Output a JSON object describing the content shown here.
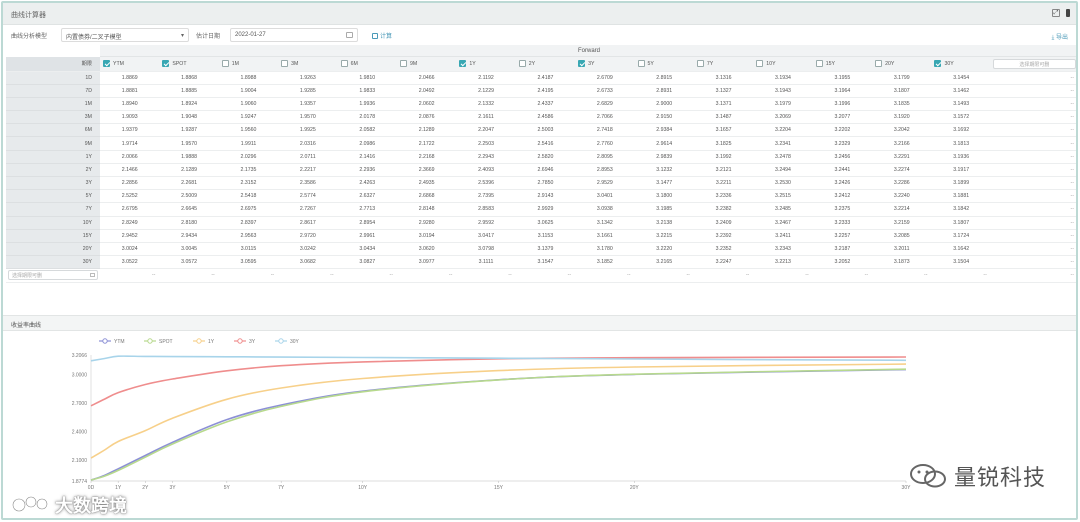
{
  "window": {
    "title": "曲线计算器"
  },
  "controls": {
    "model_label": "曲线分析模型",
    "model_value": "内置债券/二叉子模型",
    "date_label": "估计日期",
    "date_value": "2022-01-27",
    "calc_label": "计算",
    "export_label": "导出"
  },
  "grid": {
    "forward_label": "Forward",
    "corner_label": "期限",
    "columns": [
      {
        "label": "YTM",
        "checked": true
      },
      {
        "label": "SPOT",
        "checked": true
      },
      {
        "label": "1M",
        "checked": false
      },
      {
        "label": "3M",
        "checked": false
      },
      {
        "label": "6M",
        "checked": false
      },
      {
        "label": "9M",
        "checked": false
      },
      {
        "label": "1Y",
        "checked": true
      },
      {
        "label": "2Y",
        "checked": false
      },
      {
        "label": "3Y",
        "checked": true
      },
      {
        "label": "5Y",
        "checked": false
      },
      {
        "label": "7Y",
        "checked": false
      },
      {
        "label": "10Y",
        "checked": false
      },
      {
        "label": "15Y",
        "checked": false
      },
      {
        "label": "20Y",
        "checked": false
      },
      {
        "label": "30Y",
        "checked": true
      }
    ],
    "search_placeholder": "选择期限可删",
    "rows": [
      {
        "term": "1D",
        "values": [
          "1.8869",
          "1.8868",
          "1.8988",
          "1.9263",
          "1.9810",
          "2.0466",
          "2.1192",
          "2.4187",
          "2.6709",
          "2.8915",
          "3.1316",
          "3.1934",
          "3.1955",
          "3.1799",
          "3.1454"
        ]
      },
      {
        "term": "7D",
        "values": [
          "1.8881",
          "1.8885",
          "1.9004",
          "1.9285",
          "1.9833",
          "2.0492",
          "2.1229",
          "2.4195",
          "2.6733",
          "2.8931",
          "3.1327",
          "3.1943",
          "3.1964",
          "3.1807",
          "3.1462"
        ]
      },
      {
        "term": "1M",
        "values": [
          "1.8940",
          "1.8924",
          "1.9060",
          "1.9357",
          "1.9936",
          "2.0602",
          "2.1332",
          "2.4337",
          "2.6829",
          "2.9000",
          "3.1371",
          "3.1979",
          "3.1996",
          "3.1835",
          "3.1493"
        ]
      },
      {
        "term": "3M",
        "values": [
          "1.9093",
          "1.9048",
          "1.9247",
          "1.9570",
          "2.0178",
          "2.0876",
          "2.1611",
          "2.4586",
          "2.7066",
          "2.9150",
          "3.1487",
          "3.2069",
          "3.2077",
          "3.1920",
          "3.1572"
        ]
      },
      {
        "term": "6M",
        "values": [
          "1.9379",
          "1.9287",
          "1.9560",
          "1.9925",
          "2.0582",
          "2.1289",
          "2.2047",
          "2.5003",
          "2.7418",
          "2.9384",
          "3.1657",
          "3.2204",
          "3.2202",
          "3.2042",
          "3.1692"
        ]
      },
      {
        "term": "9M",
        "values": [
          "1.9714",
          "1.9570",
          "1.9911",
          "2.0316",
          "2.0986",
          "2.1722",
          "2.2503",
          "2.5416",
          "2.7760",
          "2.9614",
          "3.1825",
          "3.2341",
          "3.2329",
          "3.2166",
          "3.1813"
        ]
      },
      {
        "term": "1Y",
        "values": [
          "2.0066",
          "1.9888",
          "2.0296",
          "2.0711",
          "2.1416",
          "2.2168",
          "2.2943",
          "2.5820",
          "2.8095",
          "2.9839",
          "3.1992",
          "3.2478",
          "3.2456",
          "3.2291",
          "3.1936"
        ]
      },
      {
        "term": "2Y",
        "values": [
          "2.1466",
          "2.1289",
          "2.1735",
          "2.2217",
          "2.2936",
          "2.3669",
          "2.4093",
          "2.6946",
          "2.8953",
          "3.1232",
          "3.2121",
          "3.2494",
          "3.2441",
          "3.2274",
          "3.1917"
        ]
      },
      {
        "term": "3Y",
        "values": [
          "2.2856",
          "2.2681",
          "2.3152",
          "2.3586",
          "2.4263",
          "2.4935",
          "2.5396",
          "2.7850",
          "2.9529",
          "3.1477",
          "3.2211",
          "3.2530",
          "3.2426",
          "3.2286",
          "3.1899"
        ]
      },
      {
        "term": "5Y",
        "values": [
          "2.5252",
          "2.5009",
          "2.5418",
          "2.5774",
          "2.6327",
          "2.6868",
          "2.7395",
          "2.9143",
          "3.0401",
          "3.1800",
          "3.2336",
          "3.2515",
          "3.2412",
          "3.2240",
          "3.1881"
        ]
      },
      {
        "term": "7Y",
        "values": [
          "2.6795",
          "2.6645",
          "2.6975",
          "2.7267",
          "2.7713",
          "2.8148",
          "2.8583",
          "2.9929",
          "3.0938",
          "3.1985",
          "3.2382",
          "3.2485",
          "3.2375",
          "3.2214",
          "3.1842"
        ]
      },
      {
        "term": "10Y",
        "values": [
          "2.8249",
          "2.8180",
          "2.8397",
          "2.8617",
          "2.8954",
          "2.9280",
          "2.9592",
          "3.0625",
          "3.1342",
          "3.2138",
          "3.2409",
          "3.2467",
          "3.2333",
          "3.2159",
          "3.1807"
        ]
      },
      {
        "term": "15Y",
        "values": [
          "2.9452",
          "2.9434",
          "2.9563",
          "2.9720",
          "2.9961",
          "3.0194",
          "3.0417",
          "3.1153",
          "3.1661",
          "3.2215",
          "3.2392",
          "3.2411",
          "3.2257",
          "3.2085",
          "3.1724"
        ]
      },
      {
        "term": "20Y",
        "values": [
          "3.0024",
          "3.0045",
          "3.0115",
          "3.0242",
          "3.0434",
          "3.0620",
          "3.0798",
          "3.1379",
          "3.1780",
          "3.2220",
          "3.2352",
          "3.2343",
          "3.2187",
          "3.2011",
          "3.1642"
        ]
      },
      {
        "term": "30Y",
        "values": [
          "3.0522",
          "3.0572",
          "3.0595",
          "3.0682",
          "3.0827",
          "3.0977",
          "3.1111",
          "3.1547",
          "3.1852",
          "3.2165",
          "3.2247",
          "3.2213",
          "3.2052",
          "3.1873",
          "3.1504"
        ]
      }
    ],
    "input_placeholder": "选择期限可删",
    "empty_cell": "--"
  },
  "chart_section": {
    "title": "收益率曲线"
  },
  "chart_data": {
    "type": "line",
    "x": [
      0,
      0.5,
      1,
      2,
      3,
      5,
      7,
      10,
      15,
      20,
      30
    ],
    "xticks": [
      "0D",
      "1Y",
      "2Y",
      "3Y",
      "5Y",
      "7Y",
      "10Y",
      "15Y",
      "20Y",
      "30Y"
    ],
    "xtick_values": [
      0,
      1,
      2,
      3,
      5,
      7,
      10,
      15,
      20,
      30
    ],
    "ylim": [
      1.8774,
      3.2066
    ],
    "yticks": [
      "3.2066",
      "3.0000",
      "2.7000",
      "2.4000",
      "2.1000",
      "1.8774"
    ],
    "ytick_values": [
      3.2066,
      3.0,
      2.7,
      2.4,
      2.1,
      1.8774
    ],
    "series": [
      {
        "name": "YTM",
        "color": "#8c90d6",
        "values": [
          1.8869,
          1.9379,
          2.0066,
          2.1466,
          2.2856,
          2.5252,
          2.6795,
          2.8249,
          2.9452,
          3.0024,
          3.0522
        ]
      },
      {
        "name": "SPOT",
        "color": "#b7d98d",
        "values": [
          1.8868,
          1.9287,
          1.9888,
          2.1289,
          2.2681,
          2.5009,
          2.6645,
          2.818,
          2.9434,
          3.0045,
          3.0572
        ]
      },
      {
        "name": "1Y",
        "color": "#f7d08a",
        "values": [
          2.1192,
          2.2047,
          2.2943,
          2.4093,
          2.5396,
          2.7395,
          2.8583,
          2.9592,
          3.0417,
          3.0798,
          3.1111
        ]
      },
      {
        "name": "3Y",
        "color": "#ef8d8d",
        "values": [
          2.6709,
          2.7418,
          2.8095,
          2.8953,
          2.9529,
          3.0401,
          3.0938,
          3.1342,
          3.1661,
          3.178,
          3.1852
        ]
      },
      {
        "name": "30Y",
        "color": "#a8d4ea",
        "values": [
          3.1454,
          3.1692,
          3.1936,
          3.1917,
          3.1899,
          3.1881,
          3.1842,
          3.1807,
          3.1724,
          3.1642,
          3.1504
        ]
      }
    ]
  },
  "watermarks": {
    "right_text": "量锐科技",
    "left_text": "大数跨境"
  }
}
